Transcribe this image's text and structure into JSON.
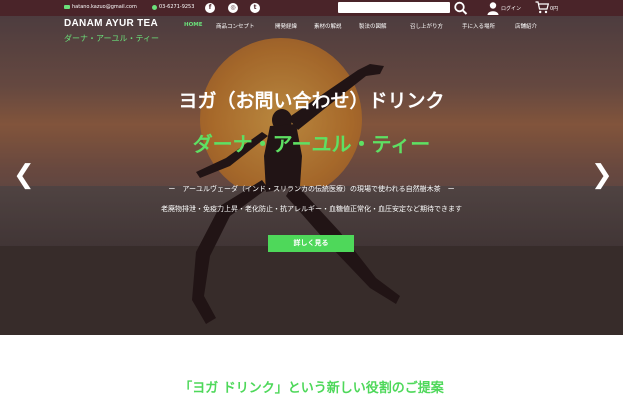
{
  "topbar": {
    "email": "hatano.kazuo@gmail.com",
    "phone": "03-6271-9253",
    "social": [
      "facebook-icon",
      "instagram-icon",
      "twitter-icon"
    ],
    "search_placeholder": "",
    "login_label": "ログイン",
    "cart_label": "0円"
  },
  "header": {
    "brand": "DANAM AYUR TEA",
    "brand_jp": "ダーナ・アーユル・ティー",
    "nav": [
      "HOME",
      "商品コンセプト",
      "開発経緯",
      "素材の解説",
      "製法の図解",
      "召し上がり方",
      "手に入る場所",
      "店舗紹介"
    ],
    "active_nav": "HOME"
  },
  "hero": {
    "title": "ヨガ（お問い合わせ）ドリンク",
    "subtitle": "ダーナ・アーユル・ティー",
    "line1": "ー　アーユルヴェーダ（インド・スリランカの伝統医療）の現場で使われる自然樹木茶　ー",
    "line2": "老廃物排泄・免疫力上昇・老化防止・抗アレルギー・血糖値正常化・血圧安定など期待できます",
    "button_label": "詳しく見る",
    "prev_icon": "chevron-left-icon",
    "next_icon": "chevron-right-icon"
  },
  "section": {
    "title": "「ヨガ ドリンク」という新しい役割のご提案"
  },
  "colors": {
    "accent": "#4ed85a",
    "topbar": "#4a2429"
  }
}
